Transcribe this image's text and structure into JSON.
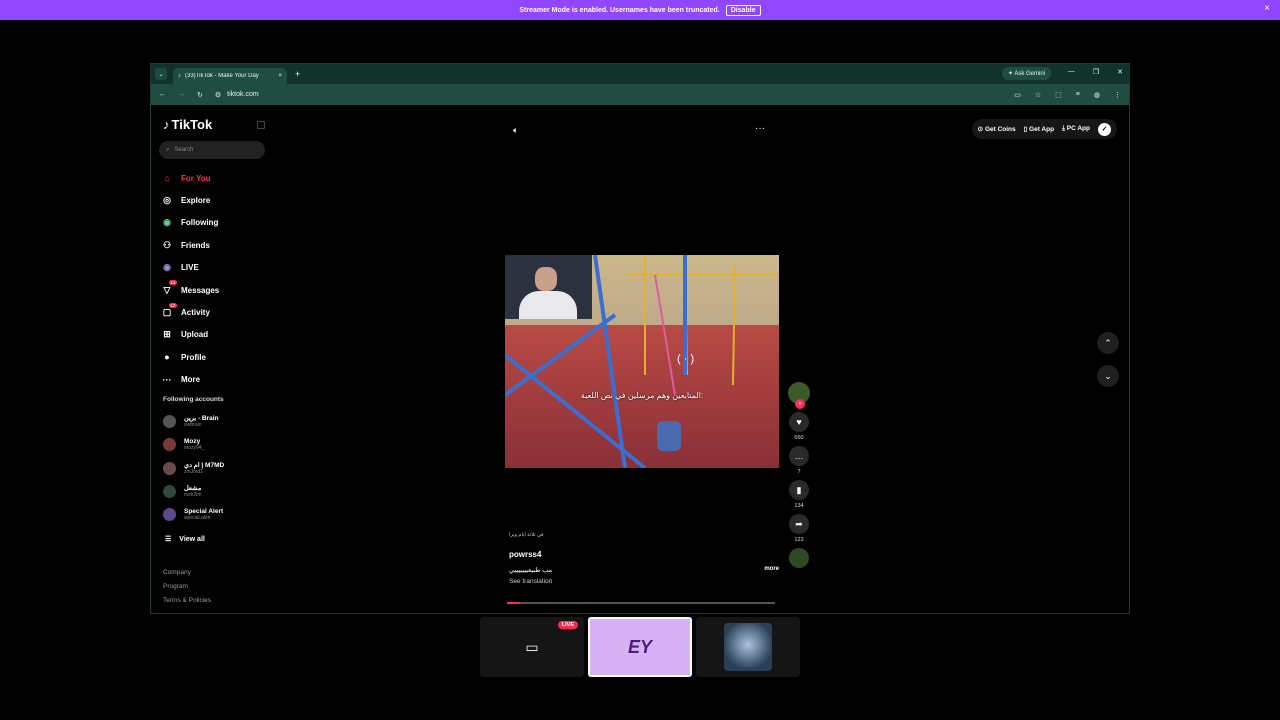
{
  "banner": {
    "message": "Streamer Mode is enabled. Usernames have been truncated.",
    "button": "Disable",
    "close": "×"
  },
  "browser": {
    "tab_title": "(33)TikTok - Make Your Day",
    "tab_close": "×",
    "new_tab": "+",
    "ask_gemini": "Ask Gemini",
    "url": "tiktok.com"
  },
  "sidebar": {
    "logo": "TikTok",
    "search_placeholder": "Search",
    "nav": [
      {
        "label": "For You",
        "icon": "home-icon",
        "glyph": "⌂"
      },
      {
        "label": "Explore",
        "icon": "compass-icon",
        "glyph": "◎"
      },
      {
        "label": "Following",
        "icon": "following-avatar-icon",
        "glyph": "◉"
      },
      {
        "label": "Friends",
        "icon": "friends-icon",
        "glyph": "⚇"
      },
      {
        "label": "LIVE",
        "icon": "live-icon",
        "glyph": "◉"
      },
      {
        "label": "Messages",
        "icon": "messages-icon",
        "glyph": "▽",
        "badge": "14"
      },
      {
        "label": "Activity",
        "icon": "activity-icon",
        "glyph": "▢",
        "badge": "17"
      },
      {
        "label": "Upload",
        "icon": "upload-icon",
        "glyph": "⊞"
      },
      {
        "label": "Profile",
        "icon": "profile-icon",
        "glyph": "●"
      },
      {
        "label": "More",
        "icon": "more-icon",
        "glyph": "···"
      }
    ],
    "following_title": "Following accounts",
    "accounts": [
      {
        "name": "برين - Brain",
        "user": "owbrain"
      },
      {
        "name": "Mozy",
        "user": "mozy94_"
      },
      {
        "name": "ام دي | M7MD",
        "user": "zmJmd1"
      },
      {
        "name": "مشعل",
        "user": "msh2lm"
      },
      {
        "name": "Special Alert",
        "user": "special.alert"
      }
    ],
    "view_all": "View all",
    "footer": [
      "Company",
      "Program",
      "Terms & Policies"
    ]
  },
  "feed": {
    "top_buttons": {
      "coins": "Get Coins",
      "app": "Get App",
      "pc": "PC App"
    },
    "video_caption": "المتابعين وهم مرسلين في نص اللعبة:",
    "small_text": "في ثلاثة ايام وبرا",
    "username": "powrss4",
    "description": "مب طبيعيييييييي",
    "more": "more",
    "see_translation": "See translation",
    "progress": 0.05,
    "stats": {
      "likes": "660",
      "comments": "7",
      "saves": "134",
      "shares": "123"
    }
  },
  "tiles": {
    "live_label": "LIVE",
    "ey": "EY"
  },
  "colors": {
    "banner": "#9146ff",
    "accent": "#fe2c55",
    "browser_chrome": "#1f4d40",
    "tile_selected": "#d6b2f5"
  }
}
